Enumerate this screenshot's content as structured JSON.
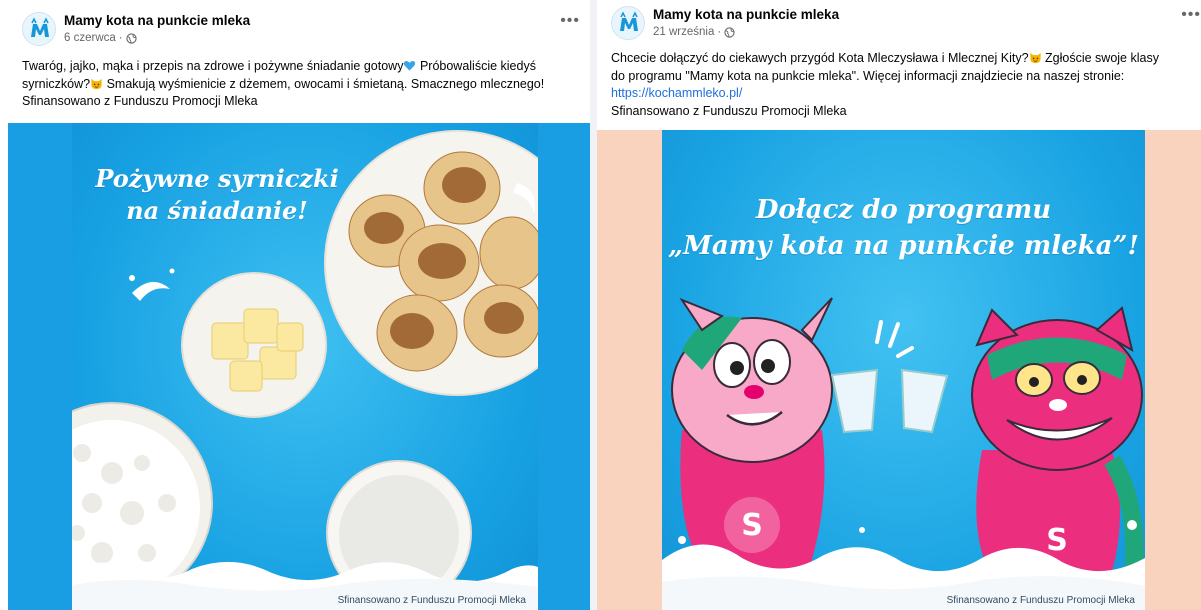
{
  "colors": {
    "link": "#216fdb",
    "image_bg_blue": "#18a2e2",
    "post2_side_bg": "#f9d3bd",
    "meta_gray": "#65676b"
  },
  "post1": {
    "page_name": "Mamy kota na punkcie mleka",
    "date": "6 czerwca",
    "more_icon": "more-horizontal-icon",
    "text_lines": [
      "Twaróg, jajko, mąka i przepis na zdrowe i pożywne śniadanie gotowy",
      "syrniczków?",
      "Smakują wyśmienicie z dżemem, owocami i śmietaną. Smacznego mlecznego!",
      "Sfinansowano z Funduszu Promocji Mleka"
    ],
    "text_line1_tail": "Próbowaliście kiedyś",
    "image": {
      "headline_line1": "Pożywne syrniczki",
      "headline_line2": "na śniadanie!",
      "credit": "Sfinansowano z Funduszu Promocji Mleka"
    }
  },
  "post2": {
    "page_name": "Mamy kota na punkcie mleka",
    "date": "21 września",
    "more_icon": "more-horizontal-icon",
    "text_line1_a": "Chcecie dołączyć do ciekawych przygód Kota Mleczysława i Mlecznej Kity?",
    "text_line1_b": "Zgłoście swoje klasy",
    "text_line2": "do programu \"Mamy kota na punkcie mleka\". Więcej informacji znajdziecie na naszej stronie:",
    "link": "https://kochammleko.pl/",
    "text_line4": "Sfinansowano z Funduszu Promocji Mleka",
    "image": {
      "headline_line1": "Dołącz do programu",
      "headline_line2": "„Mamy kota na punkcie mleka”!",
      "credit": "Sfinansowano z Funduszu Promocji Mleka"
    }
  }
}
